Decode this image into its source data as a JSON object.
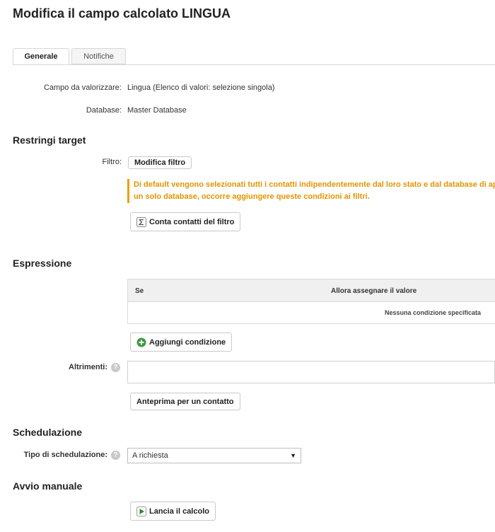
{
  "page": {
    "title": "Modifica il campo calcolato LINGUA"
  },
  "tabs": [
    {
      "label": "Generale",
      "active": true
    },
    {
      "label": "Notifiche",
      "active": false
    }
  ],
  "general": {
    "field_label": "Campo da valorizzare:",
    "field_value": "Lingua (Elenco di valori: selezione singola)",
    "database_label": "Database:",
    "database_value": "Master Database"
  },
  "target": {
    "heading": "Restringi target",
    "filter_label": "Filtro:",
    "edit_filter_button": "Modifica filtro",
    "warning_line1": "Di default vengono selezionati tutti i contatti indipendentemente dal loro stato e dal database di appartenenza. Per limitare",
    "warning_line2": "un solo database, occorre aggiungere queste condizioni ai filtri.",
    "count_button": "Conta contatti del filtro"
  },
  "expression": {
    "heading": "Espressione",
    "col_if": "Se",
    "col_then": "Allora assegnare il valore",
    "empty_text": "Nessuna condizione specificata",
    "add_condition_button": "Aggiungi condizione",
    "otherwise_label": "Altrimenti:",
    "otherwise_value": "",
    "preview_button": "Anteprima per un contatto"
  },
  "scheduling": {
    "heading": "Schedulazione",
    "type_label": "Tipo di schedulazione:",
    "type_value": "A richiesta"
  },
  "manual": {
    "heading": "Avvio manuale",
    "run_button": "Lancia il calcolo"
  },
  "colors": {
    "warning": "#e09500",
    "add_green": "#3a9a3a",
    "run_green": "#2e8b2e"
  },
  "icons": {
    "count": "sigma-icon",
    "add": "plus-circle-icon",
    "run": "play-icon",
    "help": "question-icon",
    "dropdown": "chevron-down-icon"
  }
}
